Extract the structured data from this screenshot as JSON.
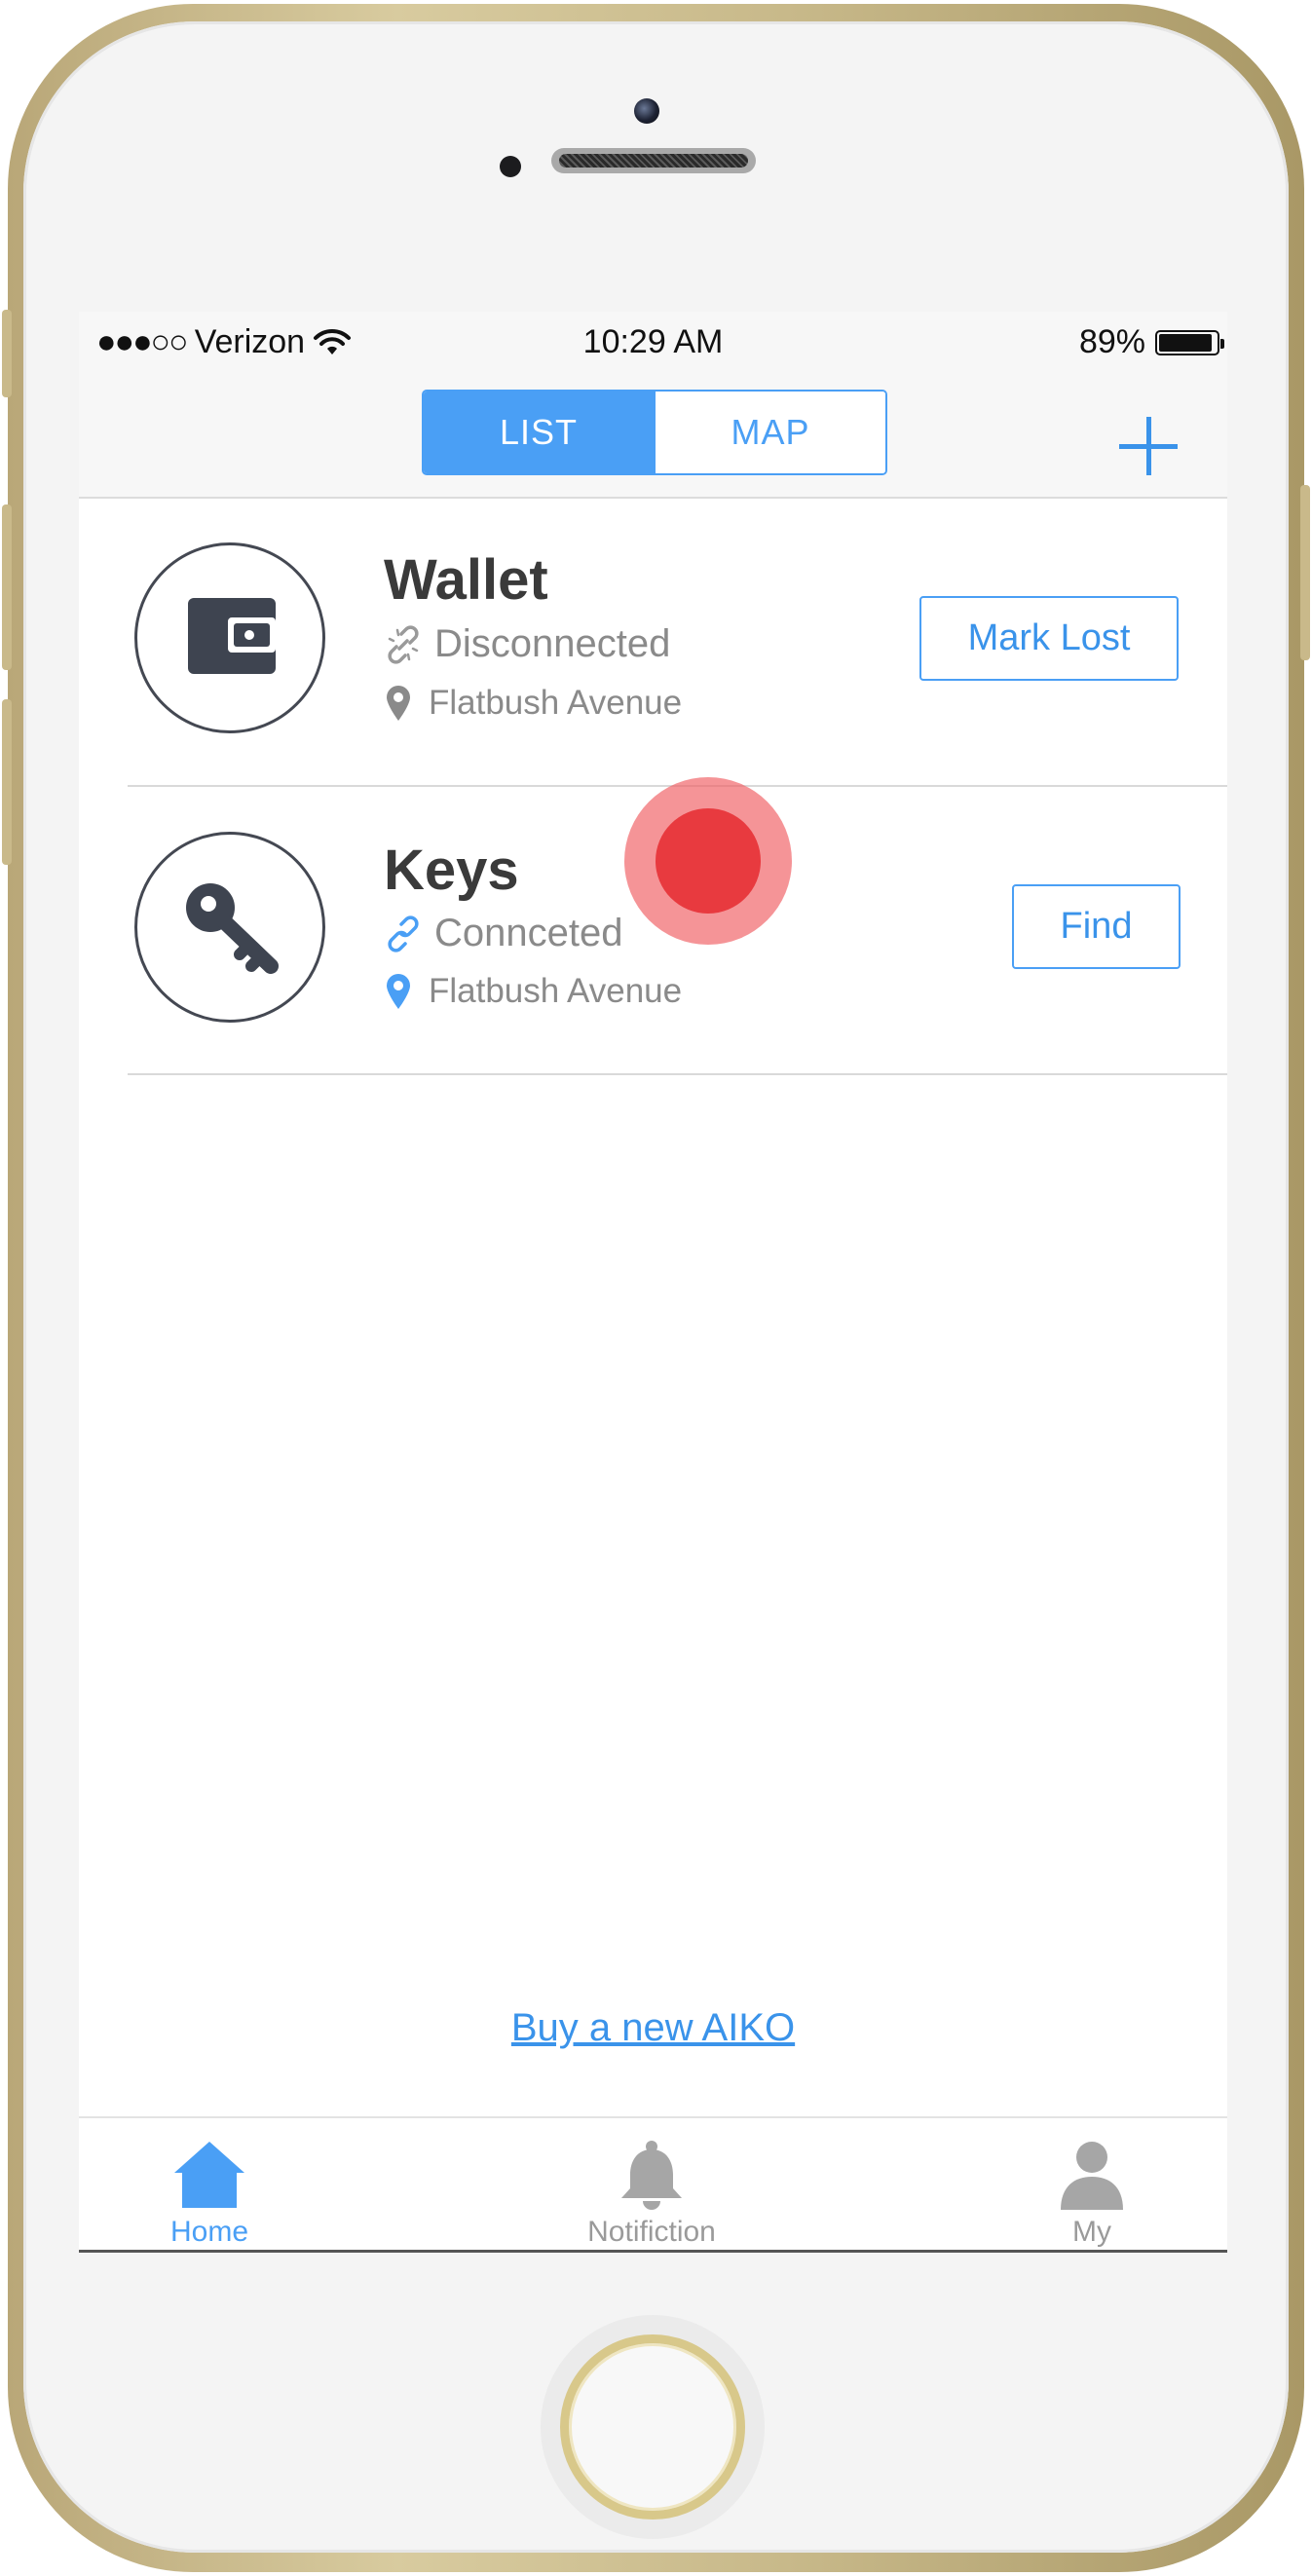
{
  "status_bar": {
    "signal": "●●●○○",
    "carrier": "Verizon",
    "time": "10:29 AM",
    "battery_percent": "89%"
  },
  "nav": {
    "segments": [
      {
        "label": "LIST",
        "active": true
      },
      {
        "label": "MAP",
        "active": false
      }
    ],
    "add_icon": "plus-icon"
  },
  "items": [
    {
      "name": "Wallet",
      "status": "Disconnected",
      "status_icon": "broken-link-icon",
      "location": "Flatbush Avenue",
      "location_icon": "location-pin-icon",
      "icon": "wallet-icon",
      "action": "Mark Lost"
    },
    {
      "name": "Keys",
      "status": "Connceted",
      "status_icon": "link-icon",
      "location": "Flatbush Avenue",
      "location_icon": "location-pin-icon",
      "icon": "key-icon",
      "action": "Find"
    }
  ],
  "buy_link": "Buy a new AIKO",
  "tabs": [
    {
      "label": "Home",
      "icon": "home-icon",
      "active": true
    },
    {
      "label": "Notifiction",
      "icon": "bell-icon",
      "active": false
    },
    {
      "label": "My",
      "icon": "user-icon",
      "active": false
    }
  ],
  "colors": {
    "accent": "#4a9ff5",
    "touch_indicator": "#e83a3f",
    "frame_gold": "#c8b98a"
  }
}
